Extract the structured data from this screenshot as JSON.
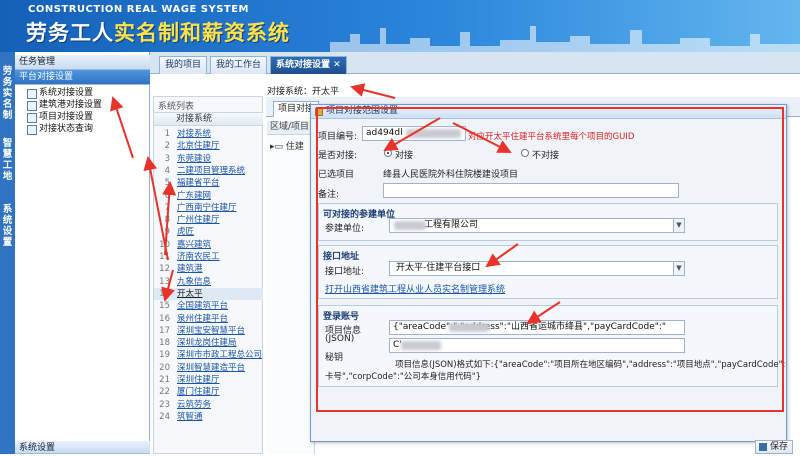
{
  "header": {
    "subtitle_en": "CONSTRUCTION REAL WAGE SYSTEM",
    "title_part1": "劳务工人",
    "title_part2": "实名制和薪资系统"
  },
  "left_strip": [
    "劳务实名制",
    "智慧工地",
    "系统设置"
  ],
  "menu": {
    "head_task": "任务管理",
    "head_platform": "平台对接设置",
    "items": [
      "系统对接设置",
      "建筑港对接设置",
      "项目对接设置",
      "对接状态查询"
    ],
    "bottom_head": "系统设置"
  },
  "tabs": [
    "我的项目",
    "我的工作台",
    "系统对接设置"
  ],
  "system_list": {
    "title": "系统列表",
    "column": "对接系统",
    "rows": [
      {
        "n": "1",
        "t": "对接系统"
      },
      {
        "n": "2",
        "t": "北京住建厅"
      },
      {
        "n": "3",
        "t": "东莞建设"
      },
      {
        "n": "4",
        "t": "二建项目管理系统"
      },
      {
        "n": "5",
        "t": "福建省平台"
      },
      {
        "n": "6",
        "t": "广东建网"
      },
      {
        "n": "7",
        "t": "广西南宁住建厅"
      },
      {
        "n": "8",
        "t": "广州住建厅"
      },
      {
        "n": "9",
        "t": "虎匠"
      },
      {
        "n": "10",
        "t": "嘉兴建筑"
      },
      {
        "n": "11",
        "t": "济南农民工"
      },
      {
        "n": "12",
        "t": "建筑港"
      },
      {
        "n": "13",
        "t": "九象信息"
      },
      {
        "n": "14",
        "t": "开太平"
      },
      {
        "n": "15",
        "t": "全国建筑平台"
      },
      {
        "n": "16",
        "t": "泉州住建平台"
      },
      {
        "n": "17",
        "t": "深圳宝安智慧平台"
      },
      {
        "n": "18",
        "t": "深圳龙岗住建局"
      },
      {
        "n": "19",
        "t": "深圳市市政工程总公司"
      },
      {
        "n": "20",
        "t": "深圳智慧建造平台"
      },
      {
        "n": "21",
        "t": "深圳住建厅"
      },
      {
        "n": "22",
        "t": "厦门住建厅"
      },
      {
        "n": "23",
        "t": "云筑劳务"
      },
      {
        "n": "24",
        "t": "筑智通"
      }
    ],
    "selected_index": 13
  },
  "right": {
    "title": "对接系统：开太平",
    "subtab": "项目对接",
    "tree_header": "区域/项目",
    "tree_node": "住建"
  },
  "dialog": {
    "title": "项目对接范围设置",
    "project_code_label": "项目编号:",
    "project_code_value": "ad494dl",
    "project_code_note": "对应开太平住建平台系统里每个项目的GUID",
    "dock_label": "是否对接:",
    "dock_yes": "对接",
    "dock_no": "不对接",
    "selected_project_label": "已选项目",
    "selected_project_value": "绛县人民医院外科住院楼建设项目",
    "remark_label": "备注:",
    "unit_section": "可对接的参建单位",
    "unit_label": "参建单位:",
    "unit_value": "工程有限公司",
    "interface_section": "接口地址",
    "interface_label": "接口地址:",
    "interface_value": "开太平-住建平台接口",
    "link_text": "打开山西省建筑工程从业人员实名制管理系统",
    "login_section": "登录账号",
    "json_label_1": "项目信息",
    "json_label_2": "(JSON)",
    "json_value": "{\"areaCode\":\"        \"address\":\"山西省运城市绛县\",\"payCardCode\":\"",
    "secret_label": "秘钥",
    "secret_value": "C'",
    "hint_line1": "项目信息(JSON)格式如下:{\"areaCode\":\"项目所在地区编码\",\"address\":\"项目地点\",\"payCardCode\":\"工资卡号\",",
    "hint_line2": "卡号\",\"corpCode\":\"公司本身信用代码\"}",
    "save": "保存"
  },
  "colors": {
    "annotation_red": "#e8322a",
    "header_blue": "#1560b8",
    "title_yellow": "#ffe24a"
  }
}
